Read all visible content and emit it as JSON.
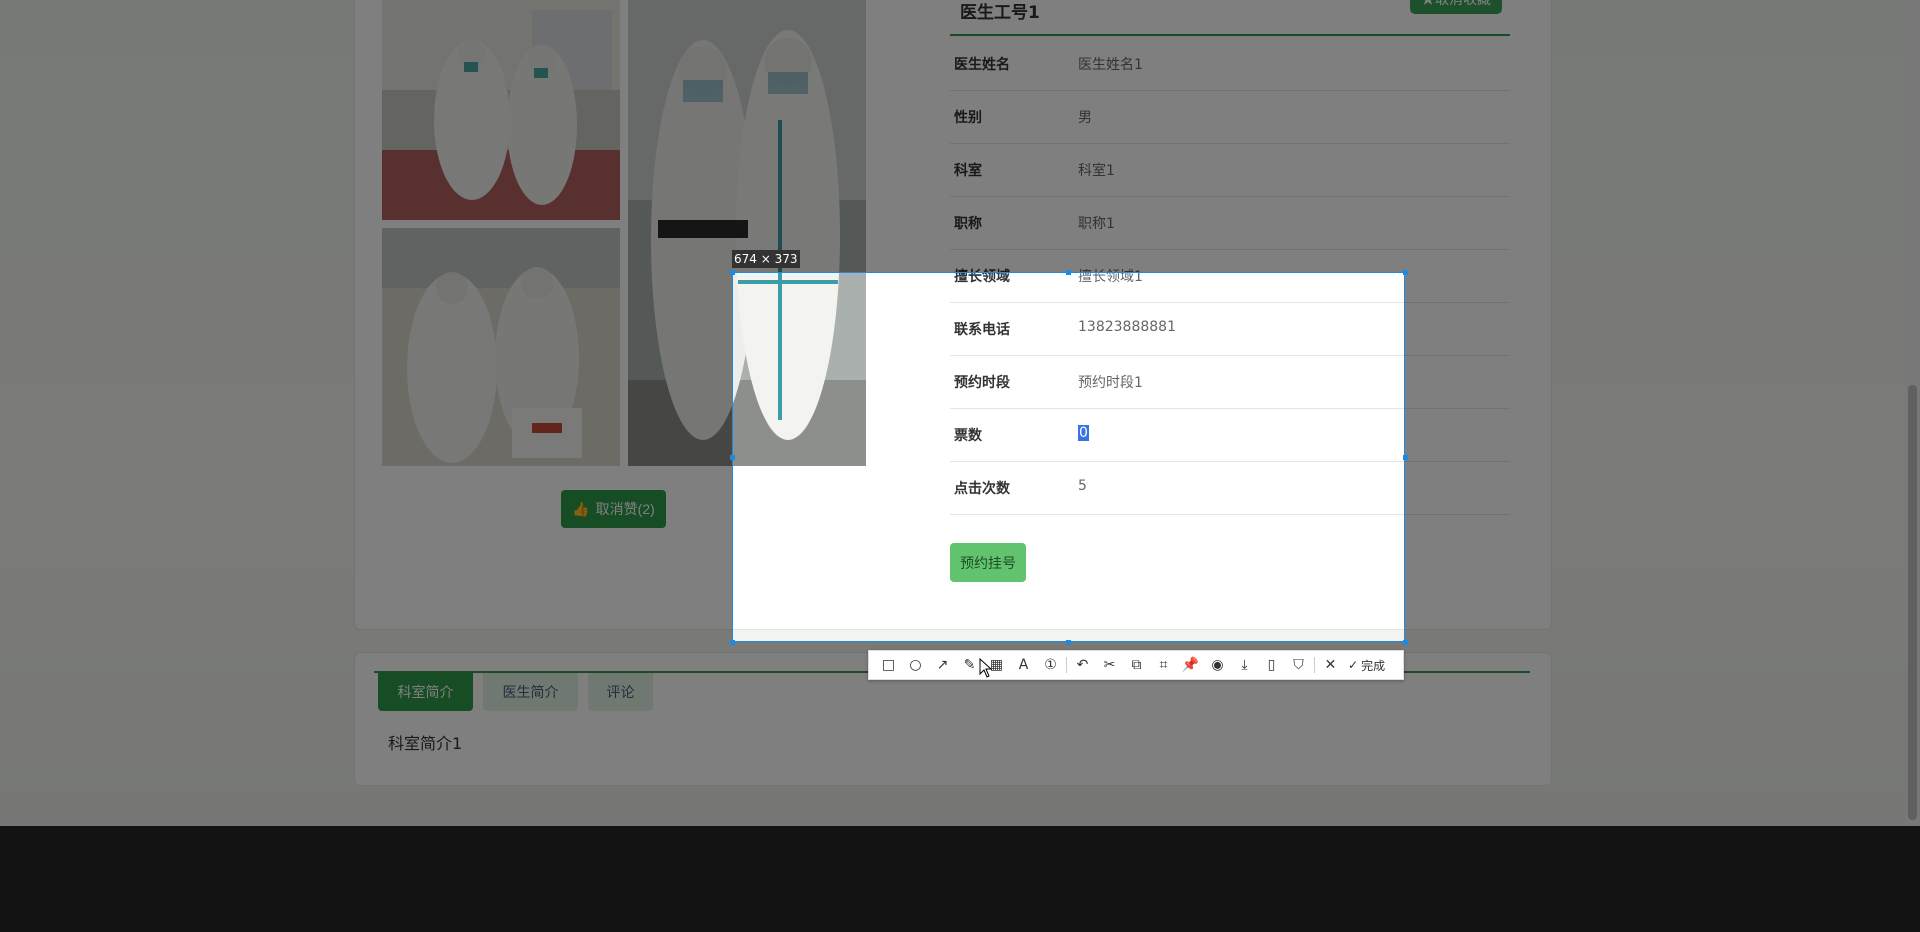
{
  "doctor": {
    "title": "医生工号1",
    "fav_label": "★取消收藏",
    "like_label": "取消赞(2)",
    "book_label": "预约挂号",
    "rows": [
      {
        "label": "医生姓名",
        "value": "医生姓名1"
      },
      {
        "label": "性别",
        "value": "男"
      },
      {
        "label": "科室",
        "value": "科室1"
      },
      {
        "label": "职称",
        "value": "职称1"
      },
      {
        "label": "擅长领域",
        "value": "擅长领域1"
      },
      {
        "label": "联系电话",
        "value": "13823888881"
      },
      {
        "label": "预约时段",
        "value": "预约时段1"
      },
      {
        "label": "票数",
        "value": "0"
      },
      {
        "label": "点击次数",
        "value": "5"
      }
    ]
  },
  "tabs": [
    {
      "label": "科室简介"
    },
    {
      "label": "医生简介"
    },
    {
      "label": "评论"
    }
  ],
  "tab_content": "科室简介1",
  "capture": {
    "size_label": "674 × 373",
    "done_label": "完成"
  },
  "colors": {
    "accent": "#2e9a4b",
    "selection": "#1f8be0"
  }
}
